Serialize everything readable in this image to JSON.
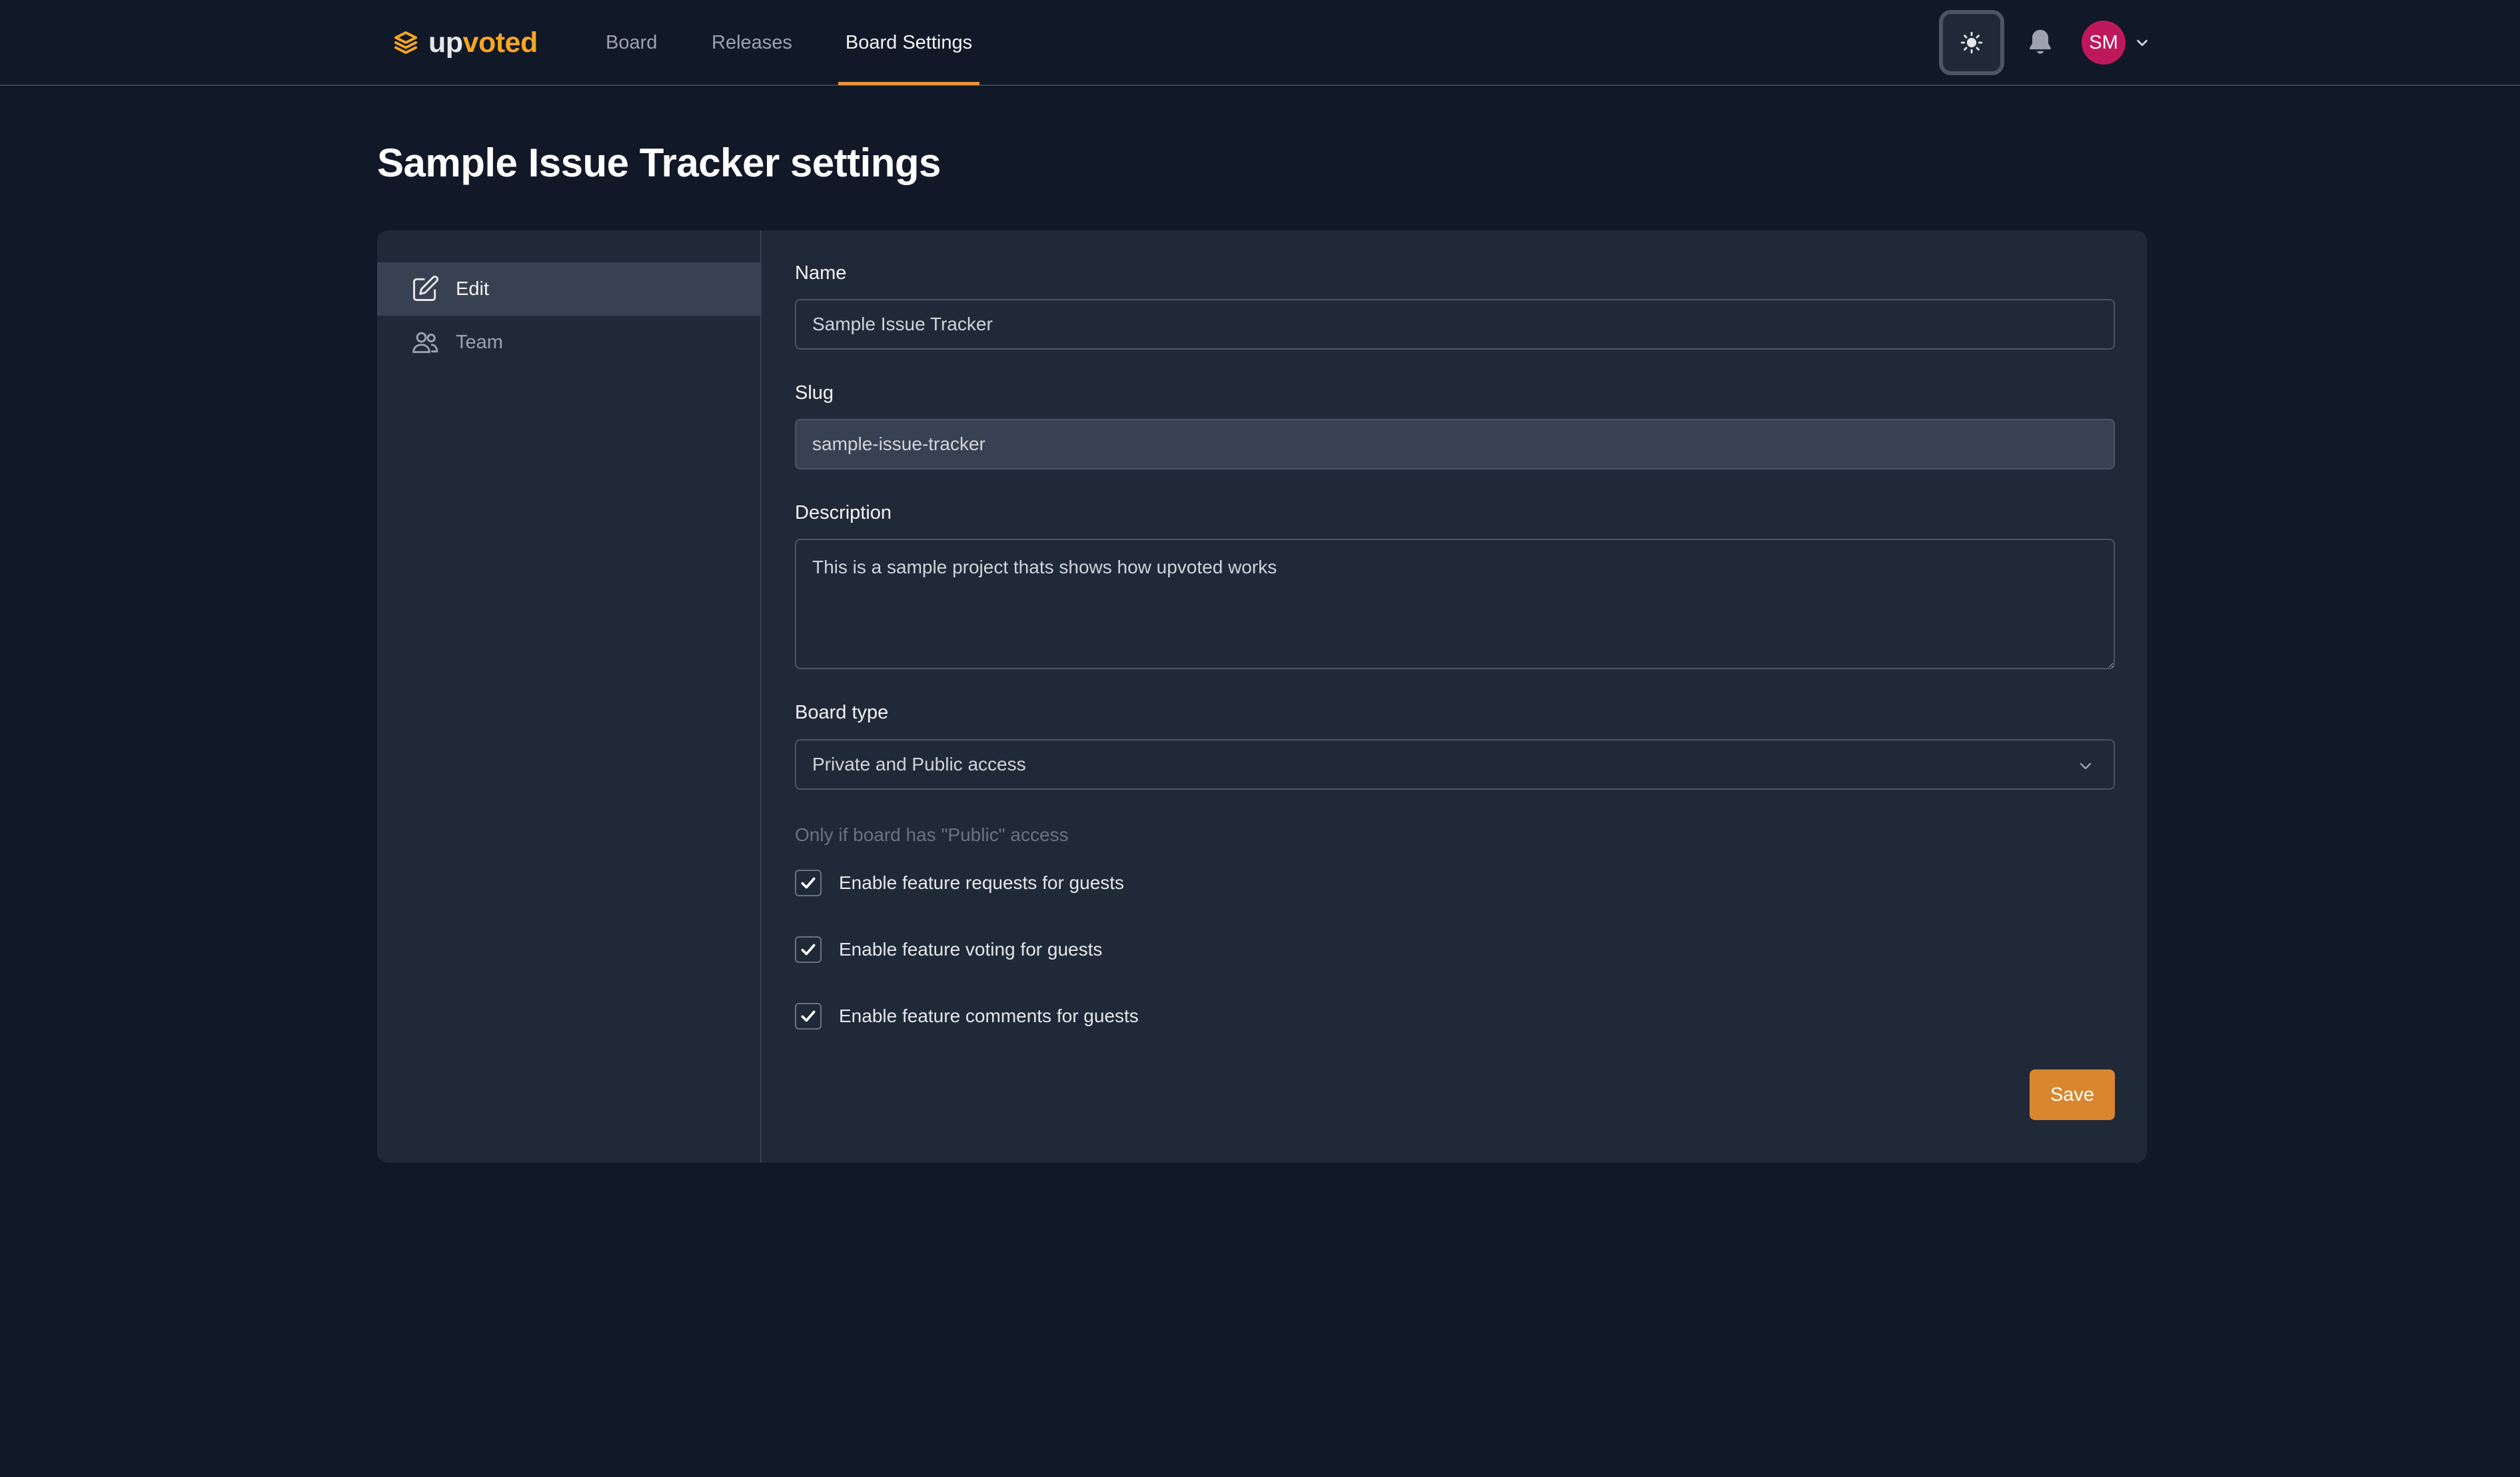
{
  "header": {
    "logo": {
      "part1": "up",
      "part2": "voted",
      "icon": "stack-icon"
    },
    "nav": [
      {
        "label": "Board",
        "active": false
      },
      {
        "label": "Releases",
        "active": false
      },
      {
        "label": "Board Settings",
        "active": true
      }
    ],
    "theme_toggle_icon": "sun-icon",
    "notifications_icon": "bell-icon",
    "user": {
      "initials": "SM",
      "color": "#be185d"
    }
  },
  "page": {
    "title": "Sample Issue Tracker settings"
  },
  "sidebar": {
    "items": [
      {
        "label": "Edit",
        "icon": "pencil-square-icon",
        "active": true
      },
      {
        "label": "Team",
        "icon": "users-icon",
        "active": false
      }
    ]
  },
  "form": {
    "name": {
      "label": "Name",
      "value": "Sample Issue Tracker"
    },
    "slug": {
      "label": "Slug",
      "value": "sample-issue-tracker"
    },
    "description": {
      "label": "Description",
      "value": "This is a sample project thats shows how upvoted works"
    },
    "board_type": {
      "label": "Board type",
      "value": "Private and Public access"
    },
    "public_hint": "Only if board has \"Public\" access",
    "options": [
      {
        "label": "Enable feature requests for guests",
        "checked": true
      },
      {
        "label": "Enable feature voting for guests",
        "checked": true
      },
      {
        "label": "Enable feature comments for guests",
        "checked": true
      }
    ],
    "save_label": "Save"
  },
  "colors": {
    "background": "#111827",
    "card": "#1f2937",
    "accent": "#d9862f",
    "logo_accent": "#f5a623"
  }
}
